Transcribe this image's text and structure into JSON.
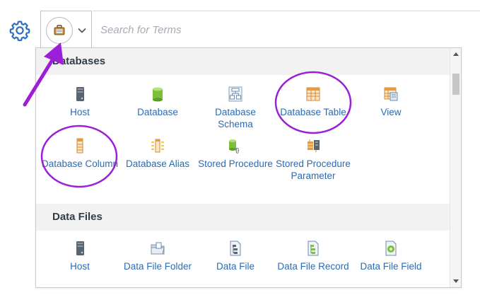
{
  "search": {
    "placeholder": "Search for Terms"
  },
  "toolbar": {
    "settings_icon": "gear-icon",
    "type_selector_icon": "briefcase-icon",
    "chevron_icon": "chevron-down-icon"
  },
  "sections": [
    {
      "title": "Databases",
      "items": [
        {
          "label": "Host",
          "icon": "server-icon"
        },
        {
          "label": "Database",
          "icon": "database-cylinder-icon"
        },
        {
          "label": "Database Schema",
          "icon": "schema-icon"
        },
        {
          "label": "Database Table",
          "icon": "table-icon"
        },
        {
          "label": "View",
          "icon": "view-icon"
        },
        {
          "label": "Database Column",
          "icon": "column-icon"
        },
        {
          "label": "Database Alias",
          "icon": "alias-icon"
        },
        {
          "label": "Stored Procedure",
          "icon": "stored-procedure-icon"
        },
        {
          "label": "Stored Procedure Parameter",
          "icon": "procedure-parameter-icon"
        }
      ]
    },
    {
      "title": "Data Files",
      "items": [
        {
          "label": "Host",
          "icon": "server-icon"
        },
        {
          "label": "Data File Folder",
          "icon": "folder-icon"
        },
        {
          "label": "Data File",
          "icon": "data-file-icon"
        },
        {
          "label": "Data File Record",
          "icon": "data-file-record-icon"
        },
        {
          "label": "Data File Field",
          "icon": "data-file-field-icon"
        }
      ]
    }
  ],
  "colors": {
    "accent_link": "#2a6bb3",
    "header_bg": "#f2f2f2",
    "annotation": "#9b1fd8"
  }
}
